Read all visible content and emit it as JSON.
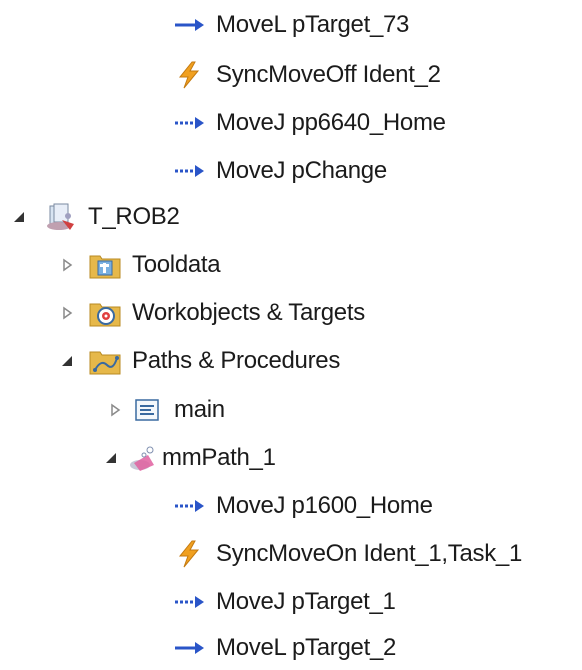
{
  "tree": {
    "instructions_top": [
      {
        "label": "MoveL pTarget_73",
        "icon": "movel-arrow-icon"
      },
      {
        "label": "SyncMoveOff Ident_2",
        "icon": "lightning-icon"
      },
      {
        "label": "MoveJ pp6640_Home",
        "icon": "movej-arrow-icon"
      },
      {
        "label": "MoveJ pChange",
        "icon": "movej-arrow-icon"
      }
    ],
    "task": {
      "label": "T_ROB2",
      "icon": "task-icon",
      "expanded": true
    },
    "folders": [
      {
        "label": "Tooldata",
        "icon": "tooldata-folder-icon",
        "expanded": false
      },
      {
        "label": "Workobjects & Targets",
        "icon": "workobjects-folder-icon",
        "expanded": false
      },
      {
        "label": "Paths & Procedures",
        "icon": "paths-folder-icon",
        "expanded": true
      }
    ],
    "procedures": [
      {
        "label": "main",
        "icon": "procedure-icon",
        "expanded": false
      },
      {
        "label": "mmPath_1",
        "icon": "path-icon",
        "expanded": true
      }
    ],
    "instructions_bottom": [
      {
        "label": "MoveJ p1600_Home",
        "icon": "movej-arrow-icon"
      },
      {
        "label": "SyncMoveOn Ident_1,Task_1",
        "icon": "lightning-icon"
      },
      {
        "label": "MoveJ pTarget_1",
        "icon": "movej-arrow-icon"
      },
      {
        "label": "MoveL pTarget_2",
        "icon": "movel-arrow-icon"
      }
    ]
  },
  "colors": {
    "movel_arrow": "#2a55c8",
    "movej_arrow": "#2a55c8",
    "lightning": "#f0a020",
    "folder": "#e6b84a"
  }
}
